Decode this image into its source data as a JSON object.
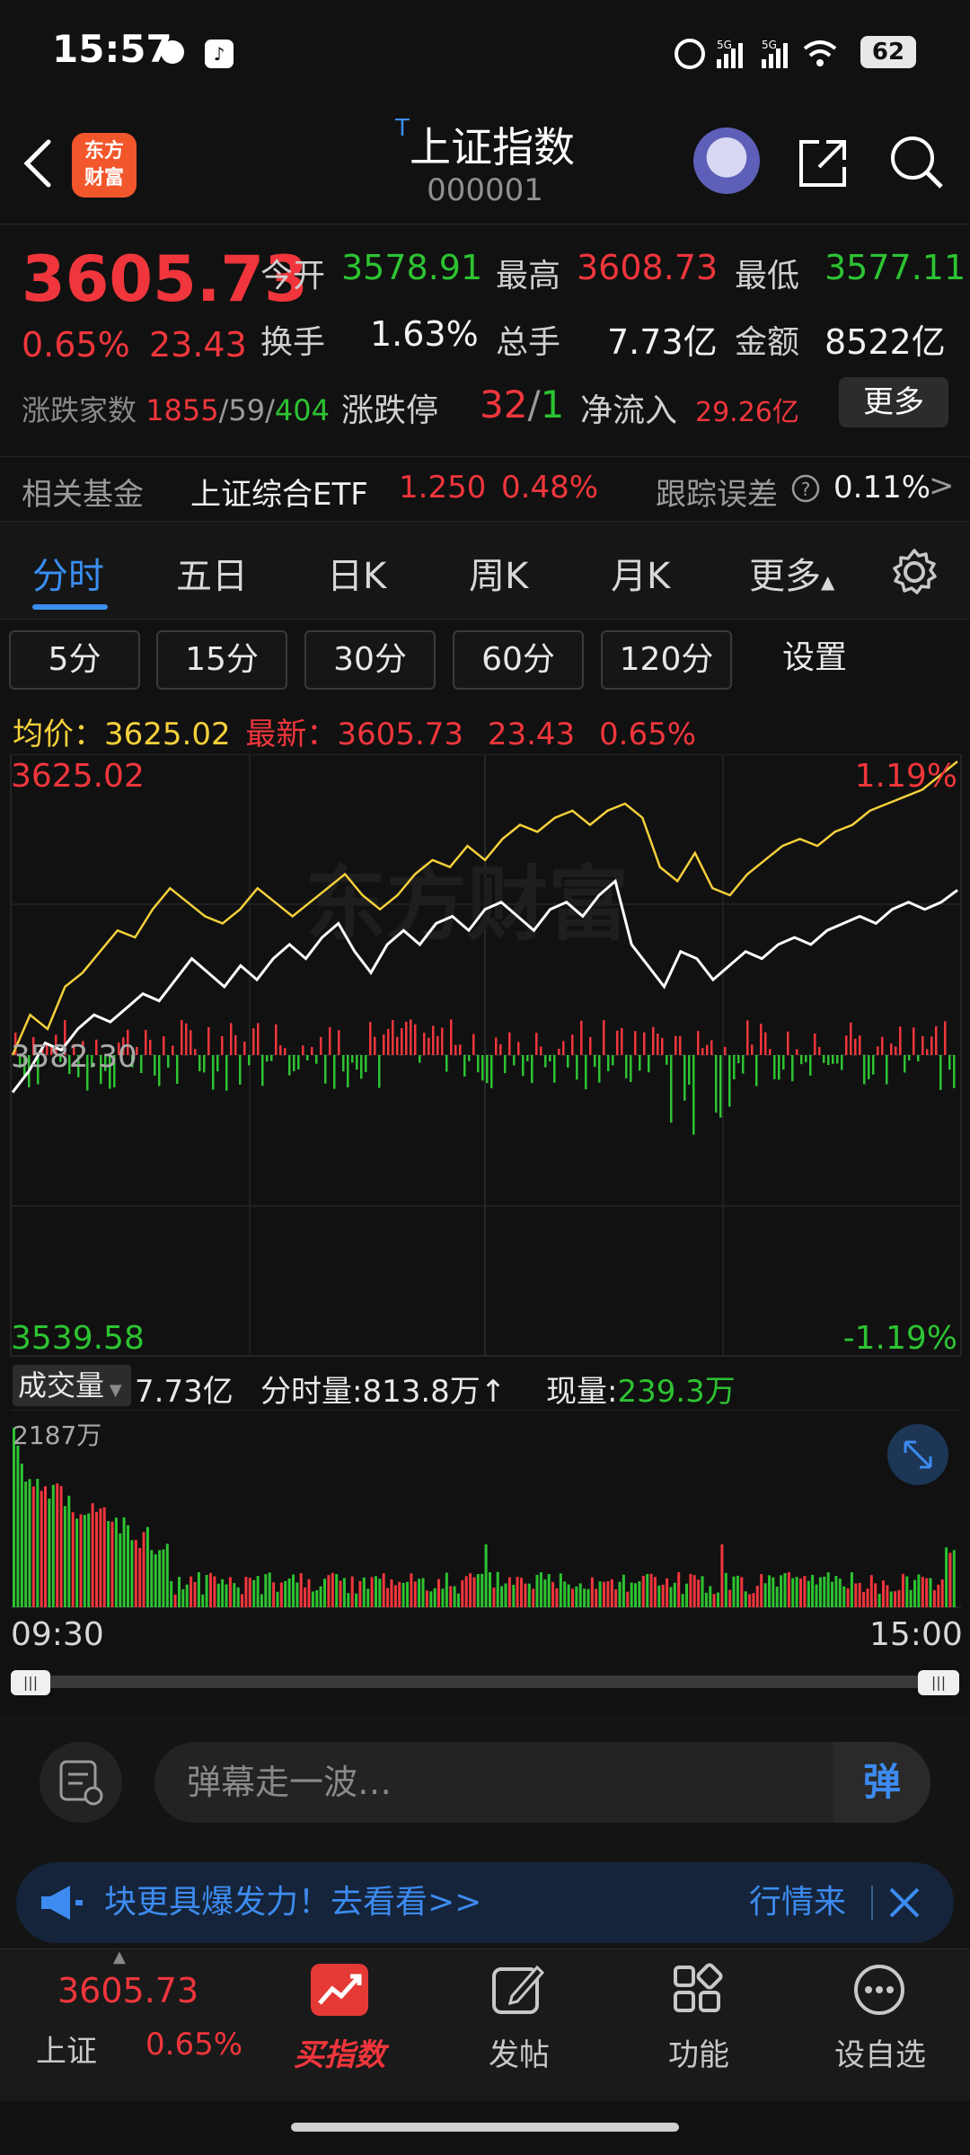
{
  "status": {
    "time": "15:57",
    "network1": "5G",
    "network2": "5G",
    "battery": "62"
  },
  "header": {
    "logo_line1": "东方",
    "logo_line2": "财富",
    "title_prefix": "T",
    "title": "上证指数",
    "code": "000001"
  },
  "quote": {
    "price": "3605.73",
    "pct": "0.65%",
    "change": "23.43",
    "open_label": "今开",
    "open": "3578.91",
    "high_label": "最高",
    "high": "3608.73",
    "low_label": "最低",
    "low": "3577.11",
    "turnover_label": "换手",
    "turnover": "1.63%",
    "total_hands_label": "总手",
    "total_hands": "7.73亿",
    "amount_label": "金额",
    "amount": "8522亿",
    "advdec_label": "涨跌家数",
    "adv": "1855",
    "flat": "59",
    "dec": "404",
    "limit_label": "涨跌停",
    "limit_up": "32",
    "limit_down": "1",
    "netflow_label": "净流入",
    "netflow": "29.26亿",
    "more": "更多"
  },
  "fund": {
    "label": "相关基金",
    "name": "上证综合ETF",
    "price": "1.250",
    "pct": "0.48%",
    "tracking_label": "跟踪误差",
    "tracking": "0.11%"
  },
  "tabs": [
    "分时",
    "五日",
    "日K",
    "周K",
    "月K",
    "更多"
  ],
  "periods": [
    "5分",
    "15分",
    "30分",
    "60分",
    "120分",
    "设置"
  ],
  "avg": {
    "avg_label": "均价：",
    "avg_value": "3625.02",
    "latest_label": "最新：",
    "latest_value": "3605.73",
    "latest_change": "23.43",
    "latest_pct": "0.65%"
  },
  "chart_axis": {
    "top_left": "3625.02",
    "top_right": "1.19%",
    "mid_left": "3582.30",
    "bottom_left": "3539.58",
    "bottom_right": "-1.19%"
  },
  "volume": {
    "label": "成交量",
    "total": "7.73亿",
    "minute_label": "分时量:",
    "minute_value": "813.8万",
    "current_label": "现量:",
    "current_value": "239.3万",
    "max": "2187万",
    "time_start": "09:30",
    "time_end": "15:00"
  },
  "danmu": {
    "placeholder": "弹幕走一波…",
    "button": "弹"
  },
  "notice": {
    "text": "块更具爆发力！去看看>>",
    "right": "行情来"
  },
  "nav": {
    "index_price": "3605.73",
    "index_name": "上证",
    "index_pct": "0.65%",
    "buy": "买指数",
    "post": "发帖",
    "func": "功能",
    "watch": "设自选"
  },
  "colors": {
    "up": "#f0363c",
    "down": "#2dc332",
    "accent": "#3a8ef0",
    "avg_line": "#f5d03b"
  },
  "chart_data": {
    "type": "line",
    "ylim": [
      3539.58,
      3625.02
    ],
    "series": [
      {
        "values": [
          3582.3,
          3588,
          3586,
          3592,
          3594,
          3597,
          3600,
          3599,
          3603,
          3606,
          3604,
          3602,
          3601,
          3603,
          3606,
          3604,
          3602,
          3604,
          3606,
          3608,
          3605,
          3603,
          3605,
          3608,
          3610,
          3609,
          3612,
          3610,
          3613,
          3615,
          3614,
          3616,
          3617,
          3615,
          3617,
          3618,
          3616,
          3609,
          3607,
          3611,
          3606,
          3605,
          3608,
          3610,
          3612,
          3613,
          3612,
          3614,
          3615,
          3617,
          3618,
          3619,
          3620,
          3622,
          3624
        ]
      },
      {
        "values": [
          3577,
          3580,
          3584,
          3583,
          3586,
          3588,
          3587,
          3589,
          3591,
          3590,
          3593,
          3596,
          3594,
          3592,
          3595,
          3593,
          3596,
          3598,
          3596,
          3599,
          3601,
          3597,
          3594,
          3598,
          3600,
          3598,
          3601,
          3602,
          3600,
          3603,
          3604,
          3602,
          3600,
          3603,
          3604,
          3602,
          3605,
          3607,
          3598,
          3595,
          3592,
          3597,
          3596,
          3593,
          3595,
          3597,
          3596,
          3598,
          3599,
          3598,
          3600,
          3601,
          3602,
          3601,
          3603,
          3604,
          3603,
          3604,
          3605.73
        ]
      }
    ]
  }
}
